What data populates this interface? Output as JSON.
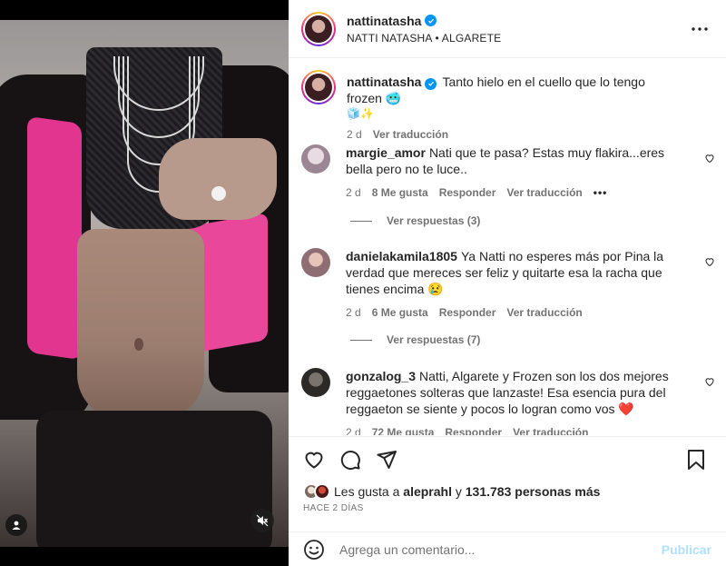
{
  "post": {
    "author": "nattinatasha",
    "subtitle": "NATTI NATASHA • ALGARETE",
    "caption_text": "Tanto hielo en el cuello que lo tengo frozen 🥶",
    "caption_emoji_line": "🧊✨",
    "caption_time": "2 d",
    "caption_translate": "Ver traducción"
  },
  "comments": [
    {
      "user": "margie_amor",
      "text": "Nati que te pasa? Estas muy flakira...eres bella pero no te luce..",
      "time": "2 d",
      "likes": "8 Me gusta",
      "reply": "Responder",
      "translate": "Ver traducción",
      "replies": "Ver respuestas (3)"
    },
    {
      "user": "danielakamila1805",
      "text": "Ya Natti no esperes más por Pina la verdad que mereces ser feliz y quitarte esa la racha que tienes encima 😢",
      "time": "2 d",
      "likes": "6 Me gusta",
      "reply": "Responder",
      "translate": "Ver traducción",
      "replies": "Ver respuestas (7)"
    },
    {
      "user": "gonzalog_3",
      "text": "Natti, Algarete y Frozen son los dos mejores reggaetones solteras que lanzaste! Esa esencia pura del reggaeton se siente y pocos lo logran como vos ❤️",
      "time": "2 d",
      "likes": "72 Me gusta",
      "reply": "Responder",
      "translate": "Ver traducción"
    }
  ],
  "likes": {
    "prefix": "Les gusta a",
    "user": "aleprahl",
    "joiner": "y",
    "count": "131.783 personas más"
  },
  "time_ago": "HACE 2 DÍAS",
  "composer": {
    "placeholder": "Agrega un comentario...",
    "publish": "Publicar"
  },
  "icons": {
    "more": "more-horizontal-icon",
    "verified": "verified-badge-icon",
    "like": "heart-icon",
    "comment": "comment-bubble-icon",
    "share": "paper-plane-icon",
    "save": "bookmark-icon",
    "emoji": "emoji-smile-icon",
    "mute": "speaker-muted-icon",
    "tag": "user-tag-icon"
  },
  "colors": {
    "verified": "#0095f6",
    "muted_text": "#737373",
    "publish_disabled": "#b2dffc",
    "jacket_pink": "#e2358f"
  }
}
